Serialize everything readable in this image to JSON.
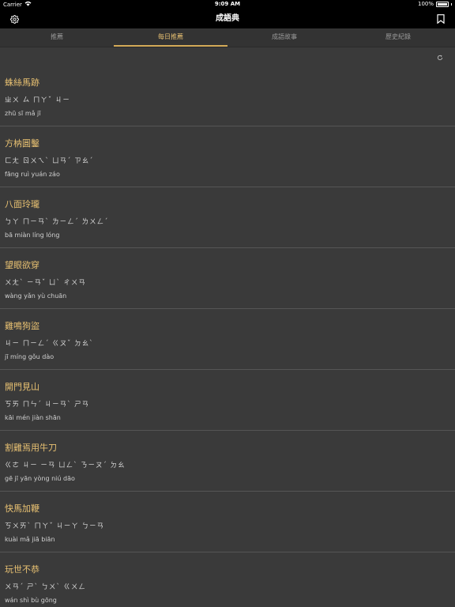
{
  "status_bar": {
    "carrier": "Carrier",
    "time": "9:09 AM",
    "battery": "100%"
  },
  "nav": {
    "title": "成語典"
  },
  "tabs": [
    {
      "label": "推薦",
      "active": false
    },
    {
      "label": "每日推薦",
      "active": true
    },
    {
      "label": "成語故事",
      "active": false
    },
    {
      "label": "歷史紀錄",
      "active": false
    }
  ],
  "colors": {
    "accent": "#e8c172",
    "background": "#3a3a3a",
    "bar": "#000000"
  },
  "items": [
    {
      "idiom": "蛛絲馬跡",
      "zhuyin": "ㄓㄨ ㄙ ㄇㄚˇ ㄐㄧ",
      "pinyin": "zhū sī mǎ jī"
    },
    {
      "idiom": "方枘圓鑿",
      "zhuyin": "ㄈㄤ ㄖㄨㄟˋ ㄩㄢˊ ㄗㄠˊ",
      "pinyin": "fāng ruì yuán záo"
    },
    {
      "idiom": "八面玲瓏",
      "zhuyin": "ㄅㄚ ㄇㄧㄢˋ ㄌㄧㄥˊ ㄌㄨㄥˊ",
      "pinyin": "bā miàn líng lóng"
    },
    {
      "idiom": "望眼欲穿",
      "zhuyin": "ㄨㄤˋ ㄧㄢˇ ㄩˋ ㄔㄨㄢ",
      "pinyin": "wàng yǎn yù chuān"
    },
    {
      "idiom": "雞鳴狗盜",
      "zhuyin": "ㄐㄧ ㄇㄧㄥˊ ㄍㄡˇ ㄉㄠˋ",
      "pinyin": "jī míng gǒu dào"
    },
    {
      "idiom": "開門見山",
      "zhuyin": "ㄎㄞ ㄇㄣˊ ㄐㄧㄢˋ ㄕㄢ",
      "pinyin": "kāi mén jiàn shān"
    },
    {
      "idiom": "割雞焉用牛刀",
      "zhuyin": "ㄍㄜ ㄐㄧ ㄧㄢ ㄩㄥˋ ㄋㄧㄡˊ ㄉㄠ",
      "pinyin": "gē jī yān yòng niú dāo"
    },
    {
      "idiom": "快馬加鞭",
      "zhuyin": "ㄎㄨㄞˋ ㄇㄚˇ ㄐㄧㄚ ㄅㄧㄢ",
      "pinyin": "kuài mǎ jiā biān"
    },
    {
      "idiom": "玩世不恭",
      "zhuyin": "ㄨㄢˊ ㄕˋ ㄅㄨˋ ㄍㄨㄥ",
      "pinyin": "wán shì bù gōng"
    }
  ]
}
